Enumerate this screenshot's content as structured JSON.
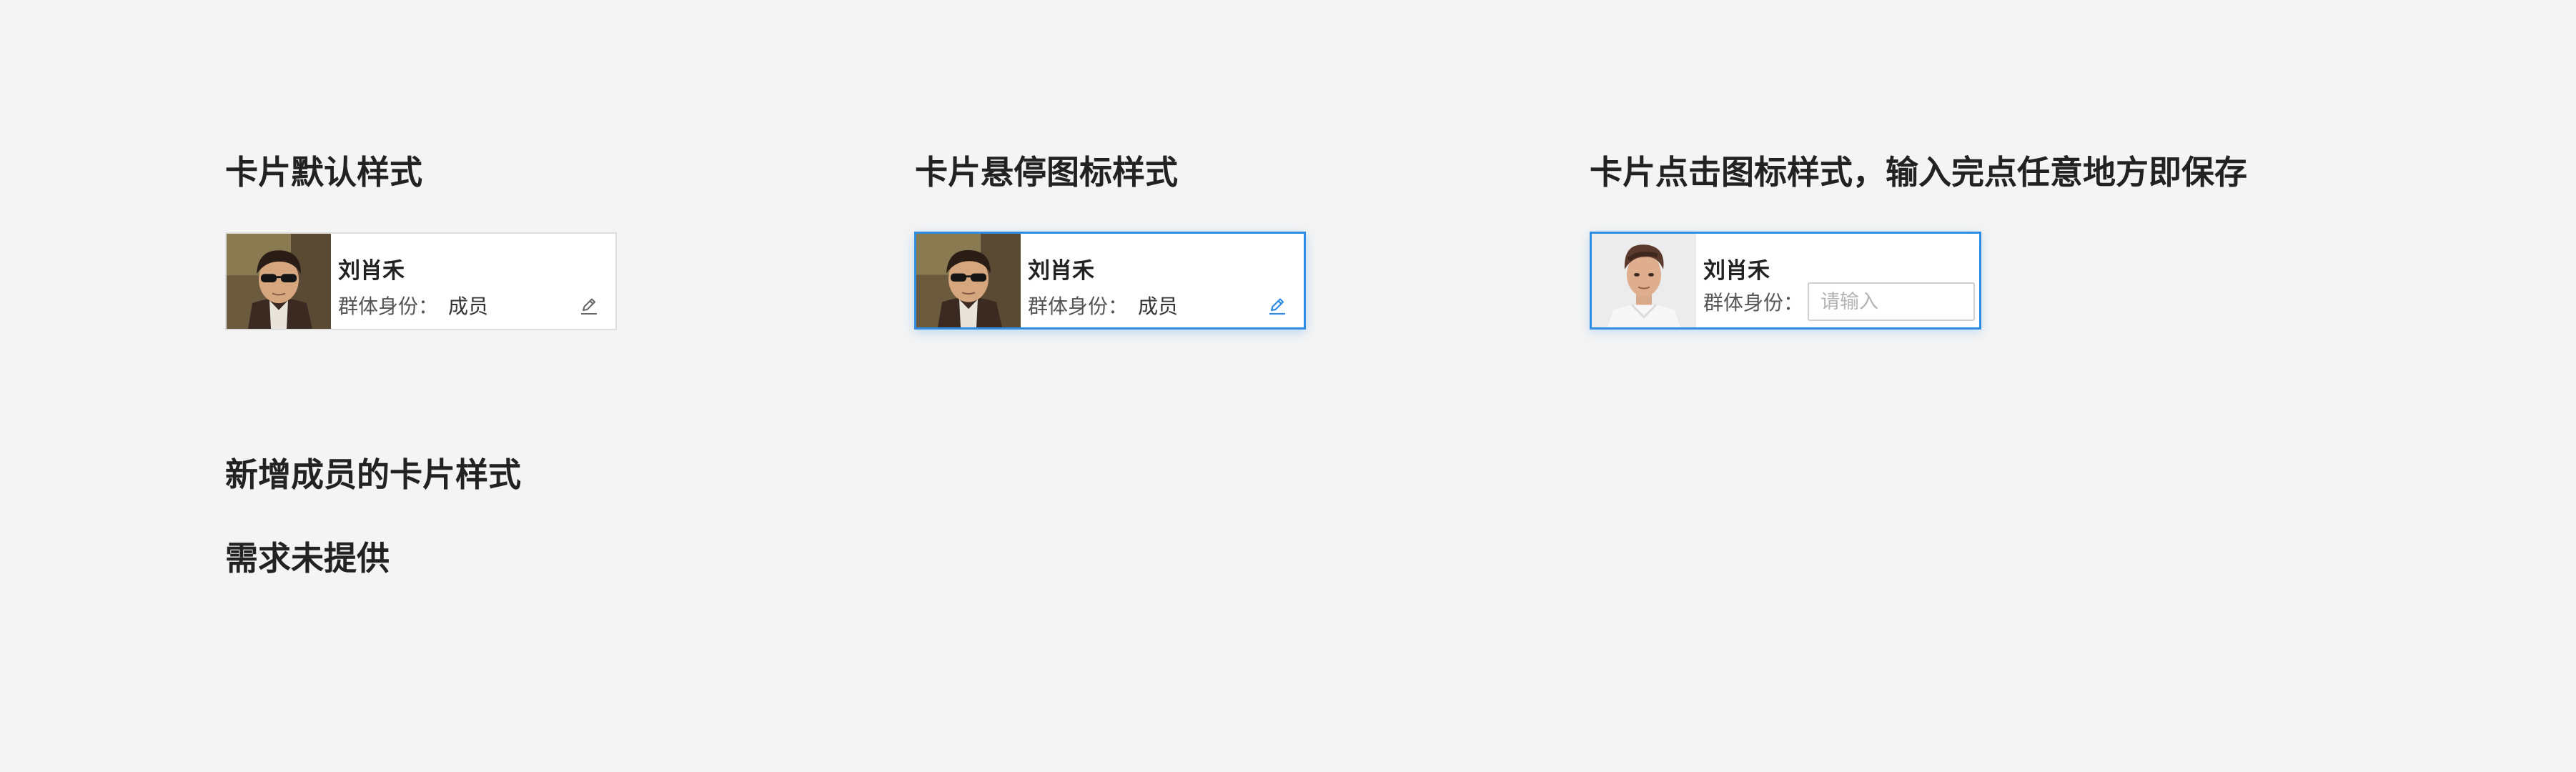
{
  "sections": {
    "default_title": "卡片默认样式",
    "hover_title": "卡片悬停图标样式",
    "edit_title": "卡片点击图标样式，输入完点任意地方即保存",
    "new_member_title": "新增成员的卡片样式",
    "new_member_note": "需求未提供"
  },
  "cards": {
    "default": {
      "name": "刘肖禾",
      "role_label": "群体身份：",
      "role_value": "成员"
    },
    "hover": {
      "name": "刘肖禾",
      "role_label": "群体身份：",
      "role_value": "成员"
    },
    "edit": {
      "name": "刘肖禾",
      "role_label": "群体身份：",
      "input_value": "",
      "input_placeholder": "请输入"
    }
  },
  "icons": {
    "edit": "pencil-edit-icon"
  },
  "colors": {
    "background": "#f4f4f4",
    "accent": "#2d8de4",
    "card_border_default": "#dedede",
    "edit_icon_default": "#666666",
    "edit_icon_hover": "#2d8de4"
  }
}
